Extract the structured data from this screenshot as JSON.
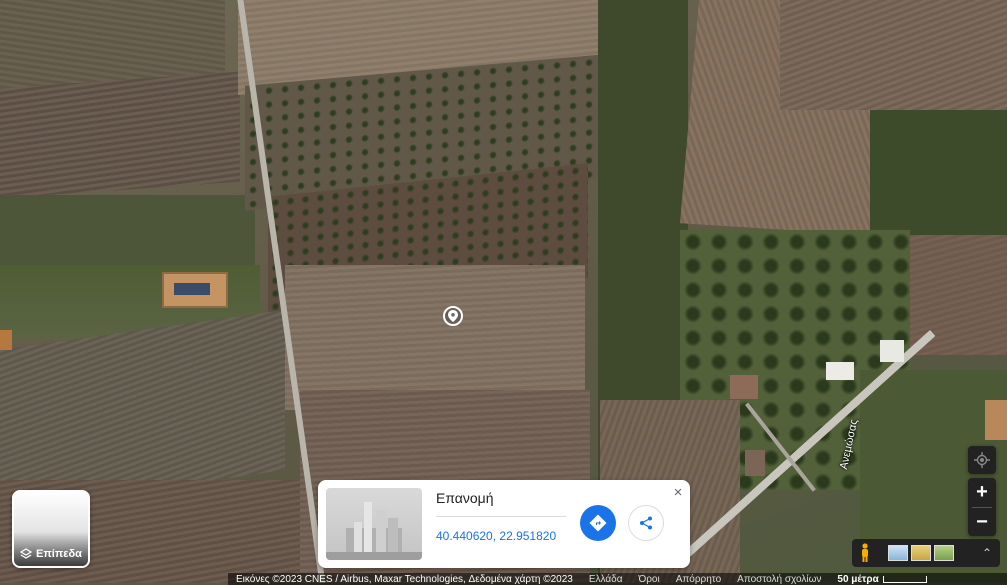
{
  "map": {
    "road_label": "Ανεμώσας"
  },
  "layers_button": {
    "label": "Επίπεδα",
    "icon": "layers-icon"
  },
  "info_card": {
    "place_name": "Επανομή",
    "coordinates": "40.440620, 22.951820",
    "directions_icon": "directions-icon",
    "share_icon": "share-icon",
    "close_label": "×"
  },
  "controls": {
    "zoom_in": "+",
    "zoom_out": "−",
    "expand": "⌃"
  },
  "footer": {
    "imagery": "Εικόνες ©2023 CNES / Airbus, Maxar Technologies, Δεδομένα χάρτη ©2023",
    "country": "Ελλάδα",
    "terms": "Όροι",
    "privacy": "Απόρρητο",
    "feedback": "Αποστολή σχολίων",
    "scale": "50 μέτρα"
  },
  "colors": {
    "accent": "#1a73e8",
    "control_bg": "#222222"
  }
}
